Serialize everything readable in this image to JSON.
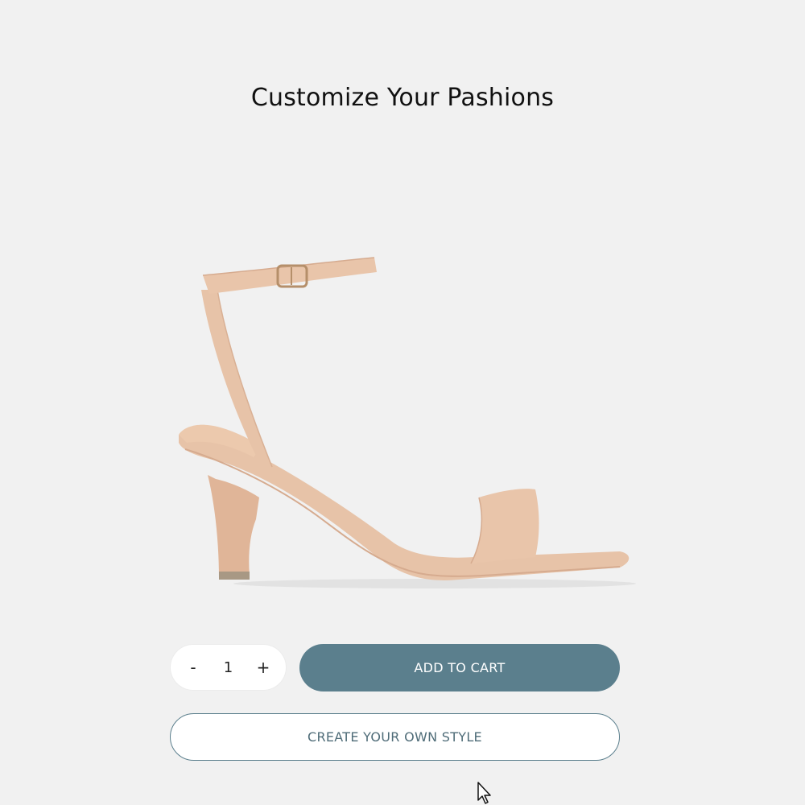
{
  "page": {
    "title": "Customize Your Pashions"
  },
  "product": {
    "image_icon": "sandal-heel-image",
    "color": "#e7c3a8"
  },
  "cart": {
    "qty_minus_label": "-",
    "qty_value": "1",
    "qty_plus_label": "+",
    "add_to_cart_label": "ADD TO CART",
    "create_style_label": "CREATE YOUR OWN STYLE"
  },
  "theme": {
    "accent": "#5b7f8d",
    "background": "#f1f1f1"
  }
}
